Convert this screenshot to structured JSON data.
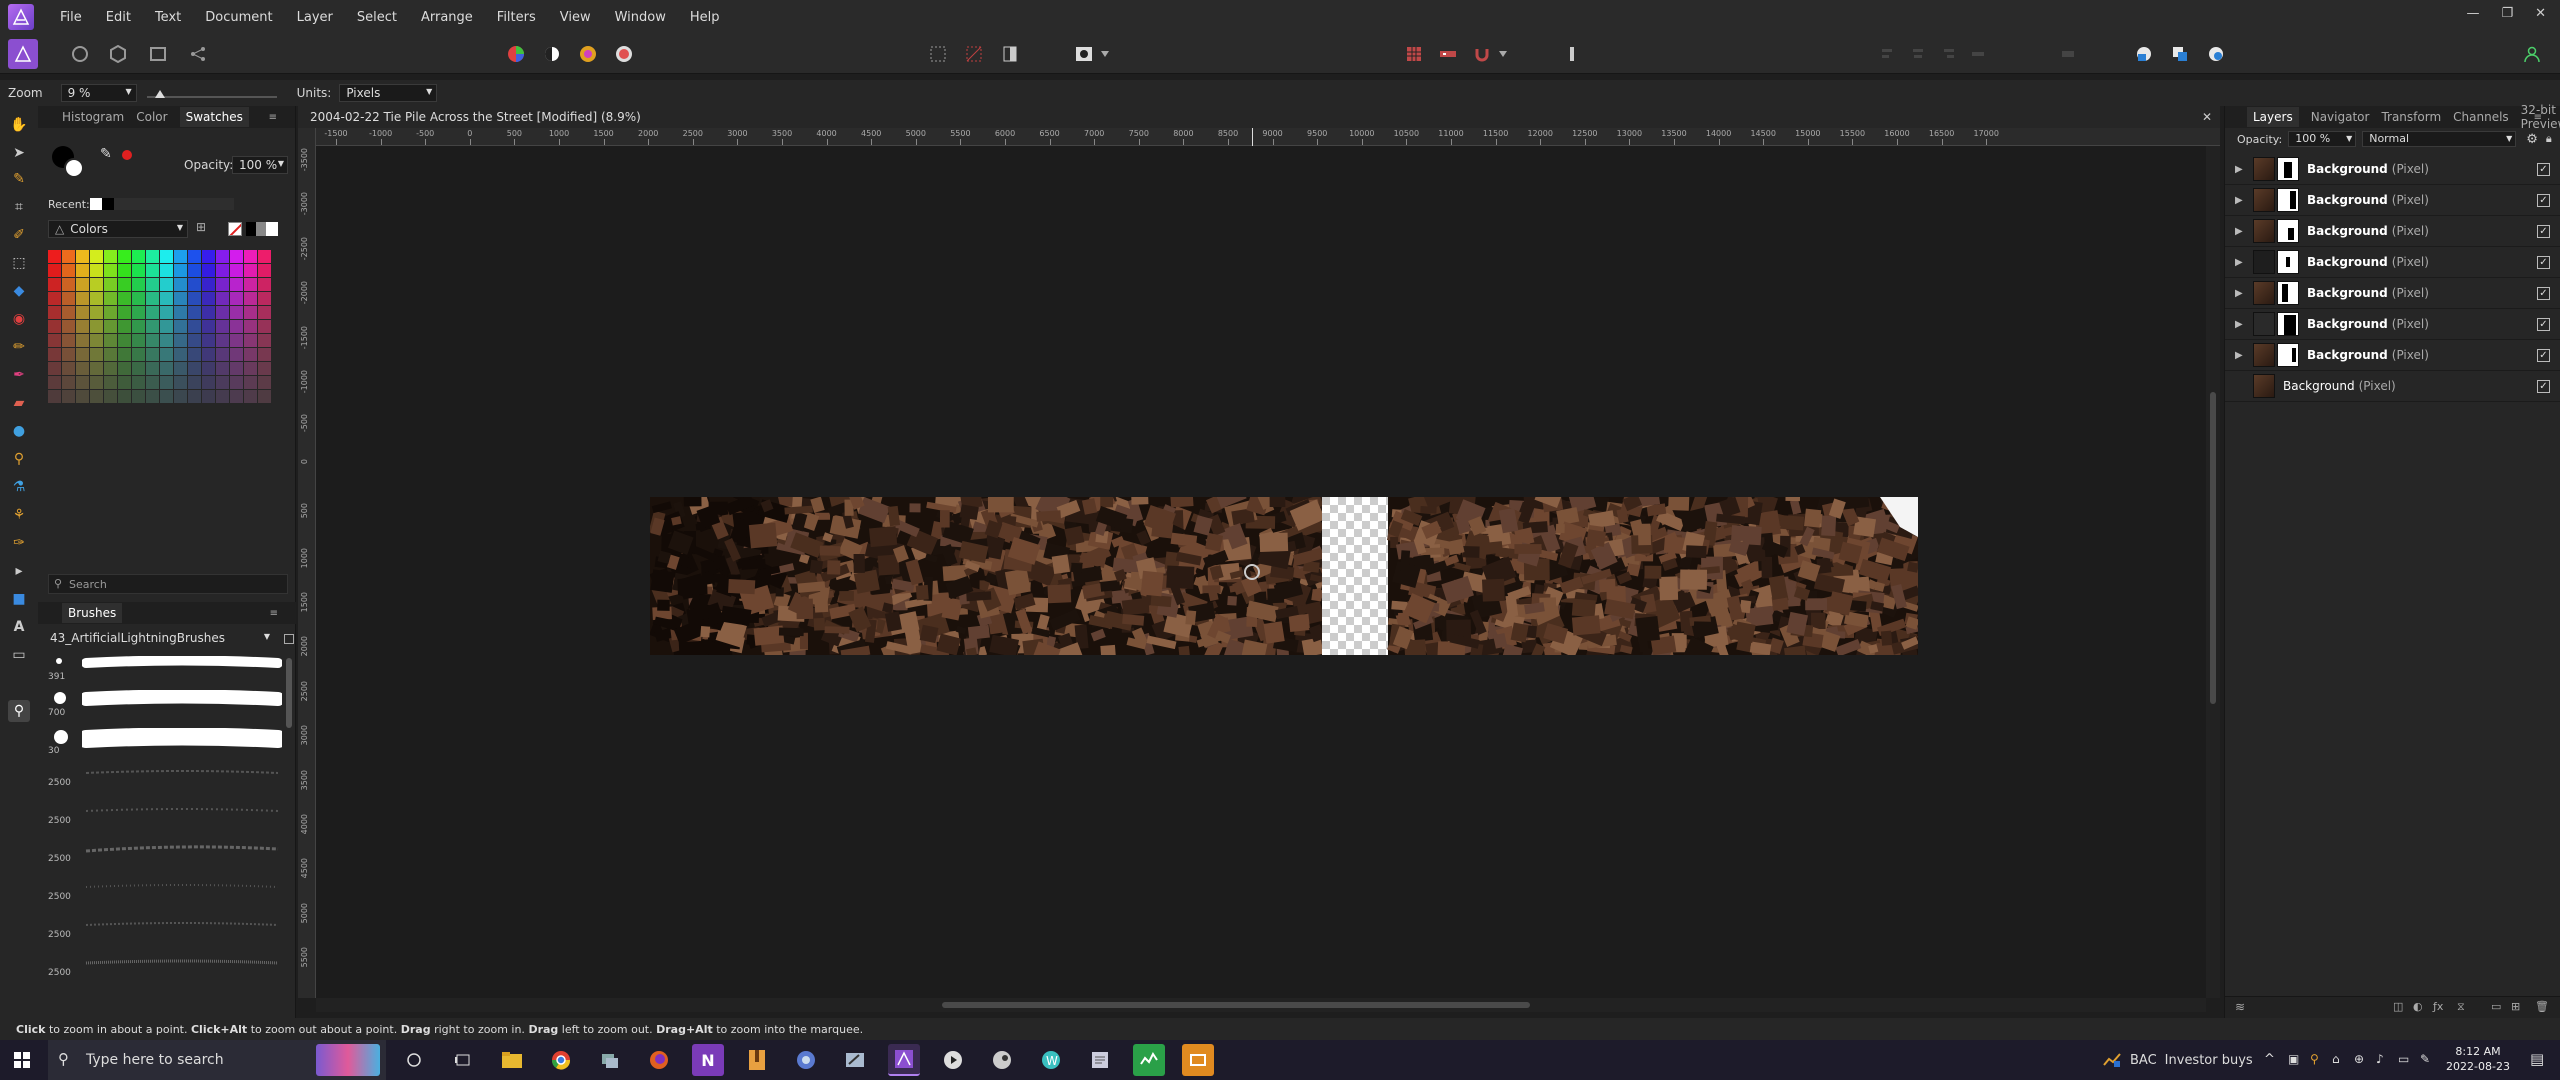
{
  "menubar": {
    "items": [
      "File",
      "Edit",
      "Text",
      "Document",
      "Layer",
      "Select",
      "Arrange",
      "Filters",
      "View",
      "Window",
      "Help"
    ]
  },
  "contextbar": {
    "zoom_label": "Zoom",
    "zoom_value": "9 %",
    "units_label": "Units:",
    "units_value": "Pixels"
  },
  "left_panel": {
    "tabs": [
      "Histogram",
      "Color",
      "Swatches"
    ],
    "active_tab": "Swatches",
    "opacity_label": "Opacity:",
    "opacity_value": "100 %",
    "recent_label": "Recent:",
    "palette_name": "Colors",
    "search_placeholder": "Search",
    "brushes_tab": "Brushes",
    "brush_category": "43_ArtificialLightningBrushes",
    "brush_sizes": [
      "391",
      "700",
      "30",
      "2500",
      "2500",
      "2500",
      "2500",
      "2500",
      "2500"
    ]
  },
  "document": {
    "title": "2004-02-22 Tie Pile Across the Street [Modified] (8.9%)",
    "ruler_top_labels": [
      "-1500",
      "-1000",
      "-500",
      "0",
      "500",
      "1000",
      "1500",
      "2000",
      "2500",
      "3000",
      "3500",
      "4000",
      "4500",
      "5000",
      "5500",
      "6000",
      "6500",
      "7000",
      "7500",
      "8000",
      "8500",
      "9000",
      "9500",
      "10000",
      "10500",
      "11000",
      "11500",
      "12000",
      "12500",
      "13000",
      "13500",
      "14000",
      "14500",
      "15000",
      "15500",
      "16000",
      "16500",
      "17000"
    ],
    "ruler_left_labels": [
      "-3500",
      "-3000",
      "-2500",
      "-2000",
      "-1500",
      "-1000",
      "-500",
      "0",
      "500",
      "1000",
      "1500",
      "2000",
      "2500",
      "3000",
      "3500",
      "4000",
      "4500",
      "5000",
      "5500"
    ]
  },
  "right_panel": {
    "tabs": [
      "Layers",
      "Navigator",
      "Transform",
      "Channels",
      "32-bit Preview"
    ],
    "active_tab": "Layers",
    "opacity_label": "Opacity:",
    "opacity_value": "100 %",
    "blend_mode": "Normal",
    "layers": [
      {
        "name": "Background",
        "type": "(Pixel)"
      },
      {
        "name": "Background",
        "type": "(Pixel)"
      },
      {
        "name": "Background",
        "type": "(Pixel)"
      },
      {
        "name": "Background",
        "type": "(Pixel)"
      },
      {
        "name": "Background",
        "type": "(Pixel)"
      },
      {
        "name": "Background",
        "type": "(Pixel)"
      },
      {
        "name": "Background",
        "type": "(Pixel)"
      },
      {
        "name": "Background",
        "type": "(Pixel)"
      }
    ]
  },
  "statusbar": {
    "t1": "Click",
    "t2": " to zoom in about a point. ",
    "t3": "Click+Alt",
    "t4": " to zoom out about a point. ",
    "t5": "Drag",
    "t6": " right to zoom in. ",
    "t7": "Drag",
    "t8": " left to zoom out. ",
    "t9": "Drag+Alt",
    "t10": " to zoom into the marquee."
  },
  "taskbar": {
    "search_placeholder": "Type here to search",
    "ticker_symbol": "BAC",
    "ticker_text": "Investor buys",
    "time": "8:12 AM",
    "date": "2022-08-23"
  },
  "colors": {
    "accent": "#9b59d0",
    "panel_bg": "#262626",
    "canvas_bg": "#1c1c1c"
  }
}
